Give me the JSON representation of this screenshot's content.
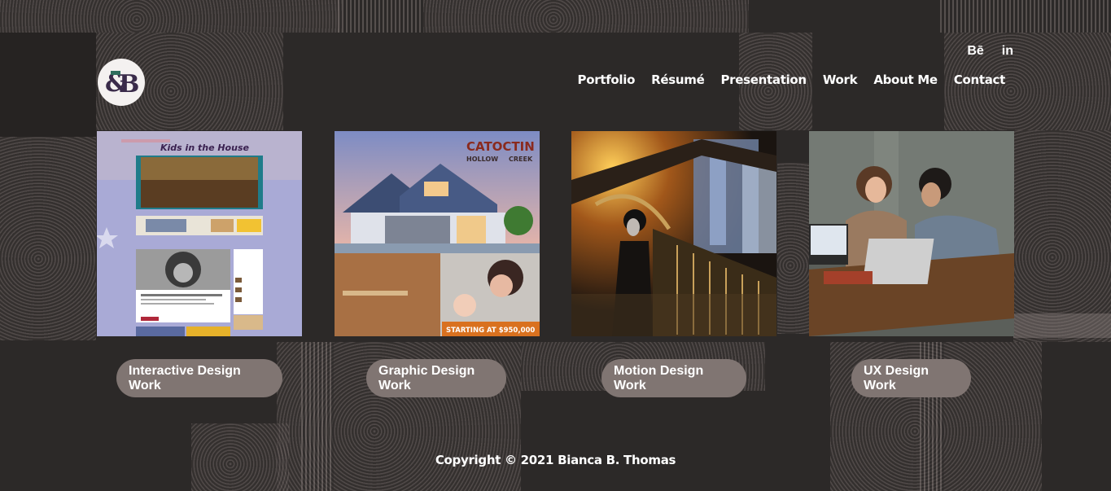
{
  "brand": {
    "logo_text": "&B",
    "logo_colors": {
      "bg": "#f4f1f0",
      "ink": "#3a2b4a",
      "accent": "#2f6e5e"
    }
  },
  "social": [
    {
      "label": "Bē",
      "icon": "behance-icon"
    },
    {
      "label": "in",
      "icon": "linkedin-icon"
    }
  ],
  "nav": [
    {
      "label": "Portfolio"
    },
    {
      "label": "Résumé"
    },
    {
      "label": "Presentation"
    },
    {
      "label": "Work"
    },
    {
      "label": "About Me"
    },
    {
      "label": "Contact"
    }
  ],
  "cards": [
    {
      "button": "Interactive Design Work",
      "image": "website-mockup-kids-in-the-house",
      "image_text": "Kids in the House"
    },
    {
      "button": "Graphic Design Work",
      "image": "real-estate-ad-house",
      "image_text": {
        "brand1": "CATOCTIN",
        "brand2": "HOLLOW",
        "brand3": "CREEK",
        "price": "STARTING AT $950,000"
      }
    },
    {
      "button": "Motion Design Work",
      "image": "woman-on-city-bridge-night"
    },
    {
      "button": "UX Design Work",
      "image": "two-people-laptops-table"
    }
  ],
  "footer": {
    "copyright": "Copyright © 2021 Bianca B. Thomas"
  },
  "colors": {
    "background": "#2c2928",
    "button_bg": "#807572",
    "text": "#ffffff"
  }
}
